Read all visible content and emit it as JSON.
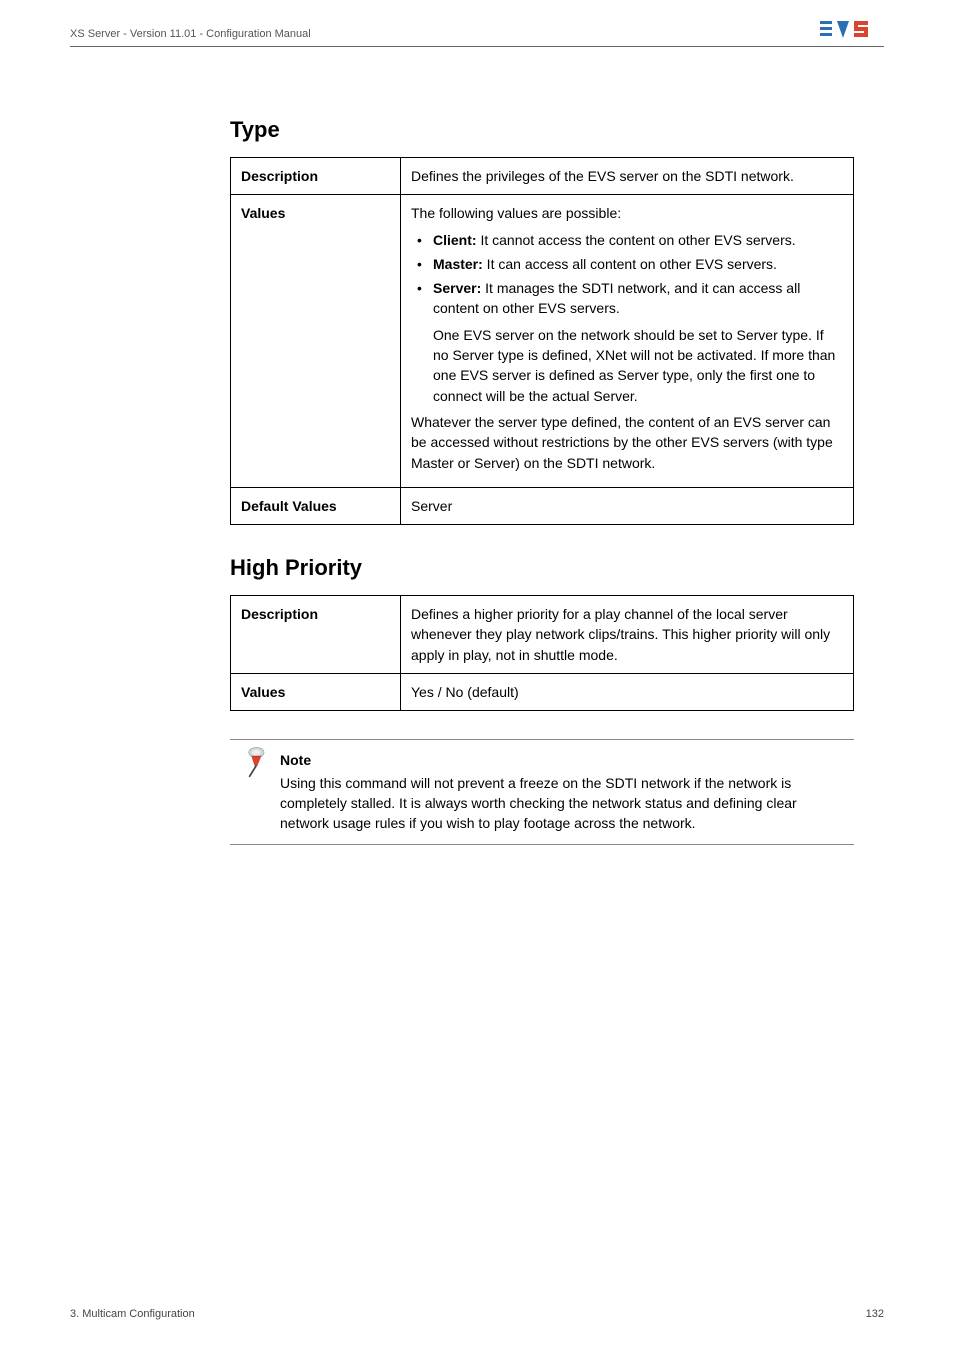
{
  "header": {
    "title": "XS Server - Version 11.01 - Configuration Manual"
  },
  "sections": {
    "type": {
      "title": "Type",
      "rows": {
        "description": {
          "label": "Description",
          "text": "Defines the privileges of the EVS server on the SDTI network."
        },
        "values": {
          "label": "Values",
          "intro": "The following values are possible:",
          "bullets": [
            {
              "b": "Client:",
              "rest": " It cannot access the content on other EVS servers."
            },
            {
              "b": "Master:",
              "rest": " It can access all content on other EVS servers."
            },
            {
              "b": "Server:",
              "rest": " It manages the SDTI network, and it can access all content on other EVS servers."
            }
          ],
          "server_note": "One EVS server on the network should be set to Server type. If no Server type is defined, XNet will not be activated. If more than one EVS server is defined as Server type, only the first one to connect will be the actual Server.",
          "whatever": "Whatever the server type defined, the content of an EVS server can be accessed without restrictions by the other EVS servers (with type Master or Server) on the SDTI network."
        },
        "default": {
          "label": "Default Values",
          "text": "Server"
        }
      }
    },
    "high_priority": {
      "title": "High Priority",
      "rows": {
        "description": {
          "label": "Description",
          "text": "Defines a higher priority for a play channel of the local server whenever they play network clips/trains. This higher priority will only apply in play, not in shuttle mode."
        },
        "values": {
          "label": "Values",
          "text": "Yes / No (default)"
        }
      }
    }
  },
  "note": {
    "title": "Note",
    "body": "Using this command will not prevent a freeze on the SDTI network if the network is completely stalled. It is always worth checking the network status and defining clear network usage rules if you wish to play footage across the network."
  },
  "footer": {
    "left": "3. Multicam Configuration",
    "right": "132"
  }
}
